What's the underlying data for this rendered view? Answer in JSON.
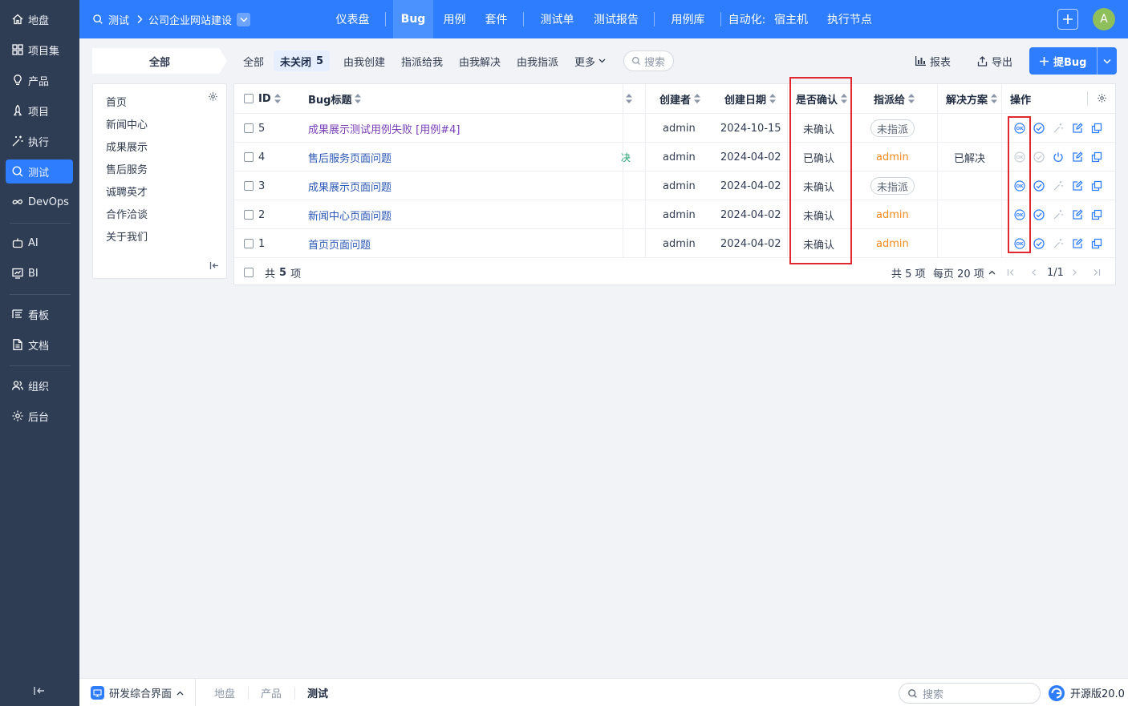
{
  "sidebar": {
    "items": [
      {
        "label": "地盘",
        "icon": "home-icon"
      },
      {
        "label": "项目集",
        "icon": "grid-icon"
      },
      {
        "label": "产品",
        "icon": "lightbulb-icon"
      },
      {
        "label": "项目",
        "icon": "rocket-icon"
      },
      {
        "label": "执行",
        "icon": "magic-wand-icon"
      },
      {
        "label": "测试",
        "icon": "search-icon"
      },
      {
        "label": "DevOps",
        "icon": "infinity-icon"
      },
      {
        "label": "AI",
        "icon": "robot-icon"
      },
      {
        "label": "BI",
        "icon": "chart-icon"
      },
      {
        "label": "看板",
        "icon": "kanban-icon"
      },
      {
        "label": "文档",
        "icon": "doc-icon"
      },
      {
        "label": "组织",
        "icon": "people-icon"
      },
      {
        "label": "后台",
        "icon": "gear-icon"
      }
    ],
    "active": "测试"
  },
  "topbar": {
    "module": "测试",
    "product": "公司企业网站建设",
    "nav": [
      "仪表盘",
      "Bug",
      "用例",
      "套件",
      "测试单",
      "测试报告",
      "用例库",
      "自动化:",
      "宿主机",
      "执行节点"
    ],
    "active_nav": "Bug",
    "avatar": "A"
  },
  "featurebar": {
    "all_tab": "全部",
    "tabs": [
      {
        "label": "全部"
      },
      {
        "label": "未关闭",
        "count": "5",
        "active": true
      },
      {
        "label": "由我创建"
      },
      {
        "label": "指派给我"
      },
      {
        "label": "由我解决"
      },
      {
        "label": "由我指派"
      },
      {
        "label": "更多"
      }
    ],
    "search_placeholder": "搜索",
    "report_label": "报表",
    "export_label": "导出",
    "create_label": "提Bug"
  },
  "tree": {
    "items": [
      "首页",
      "新闻中心",
      "成果展示",
      "售后服务",
      "诚聘英才",
      "合作洽谈",
      "关于我们"
    ]
  },
  "table": {
    "headers": {
      "id": "ID",
      "title": "Bug标题",
      "creator": "创建者",
      "date": "创建日期",
      "confirmed": "是否确认",
      "assigned": "指派给",
      "resolution": "解决方案",
      "actions": "操作"
    },
    "rows": [
      {
        "id": "5",
        "title": "成果展示测试用例失败 [用例#4]",
        "visited": true,
        "creator": "admin",
        "date": "2024-10-15",
        "confirmed": "未确认",
        "assigned": "未指派",
        "assigned_type": "pill",
        "resolution": "",
        "extra": ""
      },
      {
        "id": "4",
        "title": "售后服务页面问题",
        "visited": false,
        "creator": "admin",
        "date": "2024-04-02",
        "confirmed": "已确认",
        "assigned": "admin",
        "assigned_type": "user",
        "resolution": "已解决",
        "extra": "决"
      },
      {
        "id": "3",
        "title": "成果展示页面问题",
        "visited": false,
        "creator": "admin",
        "date": "2024-04-02",
        "confirmed": "未确认",
        "assigned": "未指派",
        "assigned_type": "pill",
        "resolution": "",
        "extra": ""
      },
      {
        "id": "2",
        "title": "新闻中心页面问题",
        "visited": false,
        "creator": "admin",
        "date": "2024-04-02",
        "confirmed": "未确认",
        "assigned": "admin",
        "assigned_type": "user",
        "resolution": "",
        "extra": ""
      },
      {
        "id": "1",
        "title": "首页页面问题",
        "visited": false,
        "creator": "admin",
        "date": "2024-04-02",
        "confirmed": "未确认",
        "assigned": "admin",
        "assigned_type": "user",
        "resolution": "",
        "extra": ""
      }
    ],
    "footer": {
      "total_prefix": "共",
      "total": "5",
      "total_suffix": "项",
      "summary": "共 5 项",
      "per_page": "每页 20 项",
      "page": "1/1"
    }
  },
  "footer": {
    "workspace": "研发综合界面",
    "crumbs": [
      "地盘",
      "产品",
      "测试"
    ],
    "search_placeholder": "搜索",
    "version": "开源版20.0"
  },
  "colors": {
    "primary": "#2e7dff",
    "sidebar": "#2e3c54",
    "highlight_box": "#e0282e",
    "admin": "#f08a1d"
  }
}
